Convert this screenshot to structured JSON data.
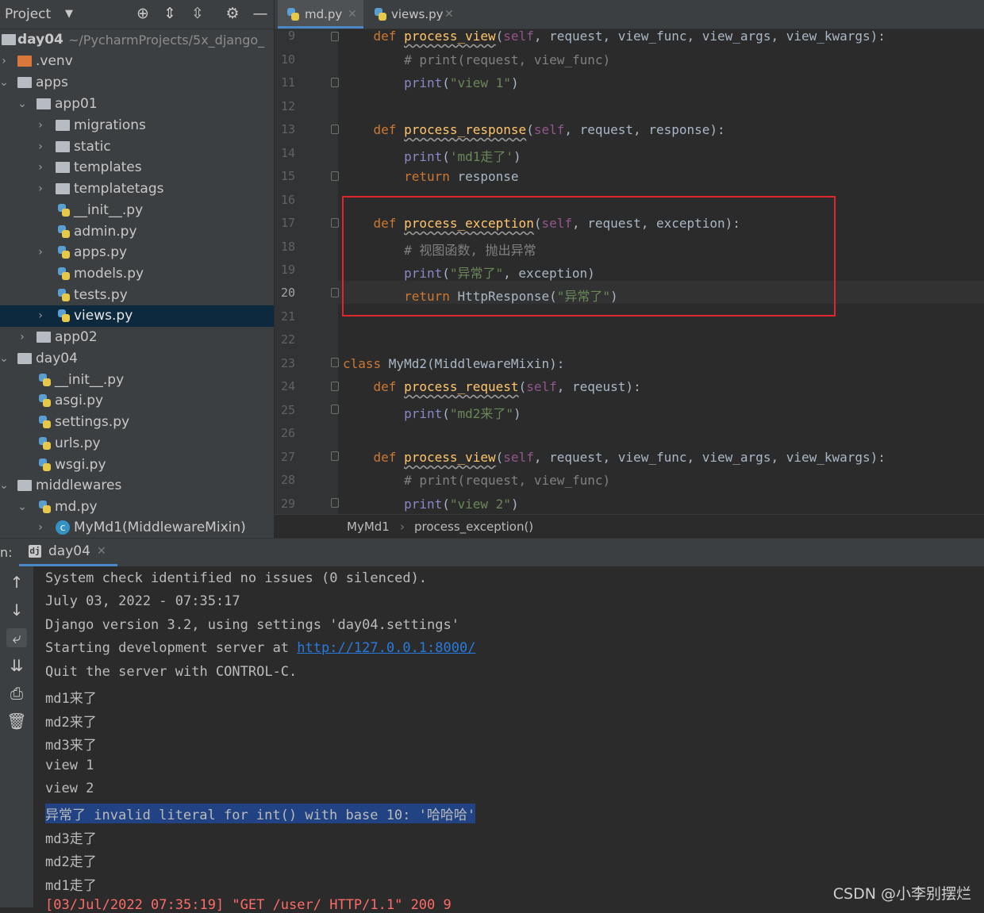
{
  "project_panel": {
    "title": "Project",
    "tree": [
      {
        "label": "day04",
        "sub": "~/PycharmProjects/5x_django_",
        "bold": true
      },
      {
        "label": ".venv"
      },
      {
        "label": "apps"
      },
      {
        "label": "app01"
      },
      {
        "label": "migrations"
      },
      {
        "label": "static"
      },
      {
        "label": "templates"
      },
      {
        "label": "templatetags"
      },
      {
        "label": "__init__.py"
      },
      {
        "label": "admin.py"
      },
      {
        "label": "apps.py"
      },
      {
        "label": "models.py"
      },
      {
        "label": "tests.py"
      },
      {
        "label": "views.py"
      },
      {
        "label": "app02"
      },
      {
        "label": "day04"
      },
      {
        "label": "__init__.py"
      },
      {
        "label": "asgi.py"
      },
      {
        "label": "settings.py"
      },
      {
        "label": "urls.py"
      },
      {
        "label": "wsgi.py"
      },
      {
        "label": "middlewares"
      },
      {
        "label": "md.py"
      },
      {
        "label": "MyMd1(MiddlewareMixin)"
      }
    ]
  },
  "editor": {
    "tabs": [
      {
        "label": "md.py"
      },
      {
        "label": "views.py"
      }
    ],
    "line_numbers": [
      "9",
      "10",
      "11",
      "12",
      "13",
      "14",
      "15",
      "16",
      "17",
      "18",
      "19",
      "20",
      "21",
      "22",
      "23",
      "24",
      "25",
      "26",
      "27",
      "28",
      "29"
    ],
    "breadcrumb": [
      "MyMd1",
      "process_exception()"
    ]
  },
  "run_panel": {
    "prefix": "n:",
    "tab_label": "day04",
    "console": [
      "System check identified no issues (0 silenced).",
      "July 03, 2022 - 07:35:17",
      "Django version 3.2, using settings 'day04.settings'",
      "Starting development server at ",
      "Quit the server with CONTROL-C.",
      "md1来了",
      "md2来了",
      "md3来了",
      "view 1",
      "view 2",
      "异常了 invalid literal for int() with base 10: '哈哈哈'",
      "md3走了",
      "md2走了",
      "md1走了",
      "[03/Jul/2022 07:35:19] \"GET /user/ HTTP/1.1\" 200 9"
    ],
    "server_link": "http://127.0.0.1:8000/"
  },
  "watermark": "CSDN @小李别摆烂",
  "colors": {
    "accent": "#4a88c7",
    "highlight_box": "#e0262c",
    "selection": "#214283"
  }
}
